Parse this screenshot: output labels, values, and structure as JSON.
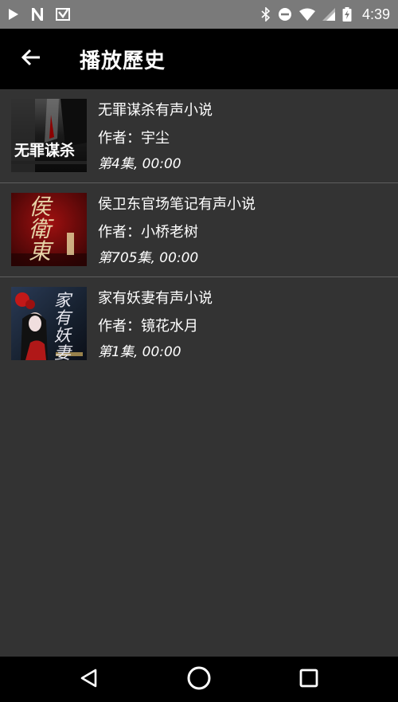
{
  "status_bar": {
    "time": "4:39",
    "icons": [
      "play-icon",
      "n-icon",
      "download-icon",
      "bluetooth-icon",
      "do-not-disturb-icon",
      "wifi-icon",
      "signal-icon",
      "battery-charging-icon"
    ]
  },
  "app_bar": {
    "title": "播放歷史",
    "back_icon": "arrow-back-icon"
  },
  "history": {
    "items": [
      {
        "title": "无罪谋杀有声小说",
        "author": "作者：宇尘",
        "episode": "第4集, 00:00",
        "cover_text": "无罪谋杀"
      },
      {
        "title": "侯卫东官场笔记有声小说",
        "author": "作者：小桥老树",
        "episode": "第705集, 00:00",
        "cover_text": "侯衛東"
      },
      {
        "title": "家有妖妻有声小说",
        "author": "作者：镜花水月",
        "episode": "第1集, 00:00",
        "cover_text": "家有妖妻"
      }
    ]
  },
  "nav_bar": {
    "icons": [
      "back-triangle-icon",
      "home-circle-icon",
      "recents-square-icon"
    ]
  },
  "colors": {
    "background": "#333333",
    "app_bar": "#000000",
    "status_bar": "#7a7a7a",
    "divider": "#5e5e5e",
    "text": "#ffffff"
  }
}
